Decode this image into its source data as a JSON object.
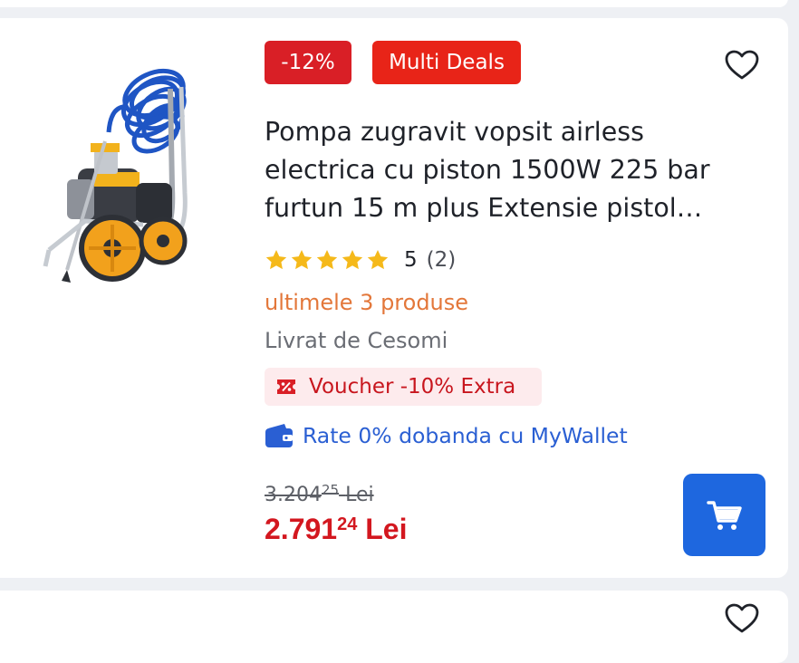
{
  "product": {
    "discount_badge": "-12%",
    "deal_badge": "Multi Deals",
    "title": "Pompa zugravit vopsit airless electrica cu piston 1500W 225 bar furtun 15 m plus Extensie pistol…",
    "rating": {
      "value": "5",
      "count": "(2)",
      "stars": 5
    },
    "stock": "ultimele 3 produse",
    "seller": "Livrat de Cesomi",
    "voucher": "Voucher -10% Extra",
    "wallet": "Rate 0% dobanda cu MyWallet",
    "old_price": {
      "integer": "3.204",
      "decimals": "25",
      "currency": "Lei"
    },
    "new_price": {
      "integer": "2.791",
      "decimals": "24",
      "currency": "Lei"
    }
  },
  "icons": {
    "favorite": "heart-outline-icon",
    "cart": "shopping-cart-icon",
    "voucher": "voucher-percent-icon",
    "wallet": "wallet-icon",
    "star": "star-icon"
  },
  "colors": {
    "discount_badge": "#d91f26",
    "deal_badge": "#e82418",
    "price": "#d3171f",
    "stock": "#e3773a",
    "star": "#f5b91a",
    "wallet": "#2a5fd3",
    "cart_button": "#1e67df",
    "voucher_bg": "#fdebed"
  }
}
